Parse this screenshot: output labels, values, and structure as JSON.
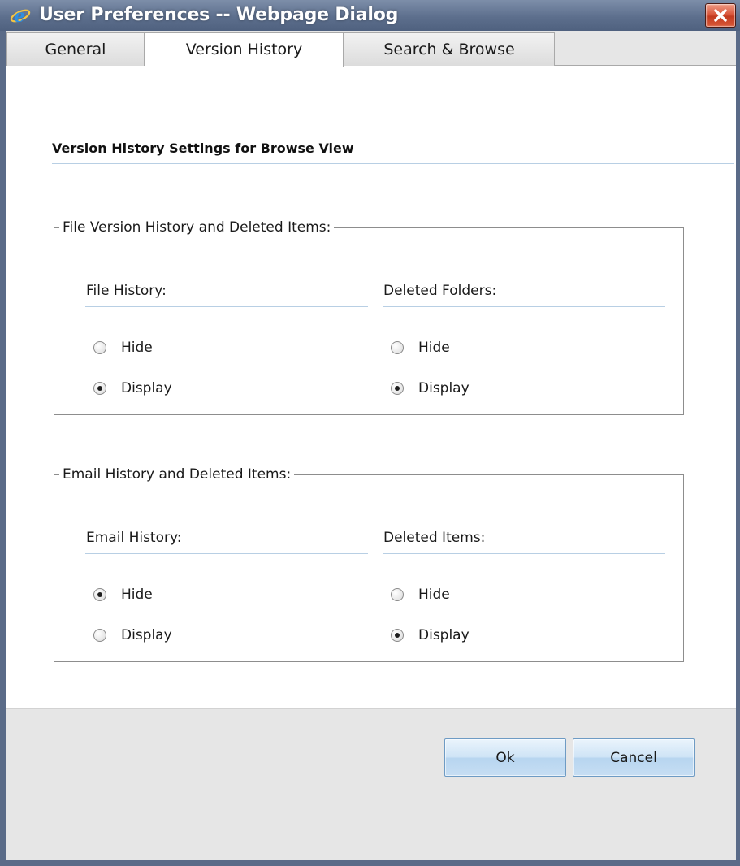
{
  "window": {
    "title": "User Preferences -- Webpage Dialog",
    "app_icon": "ie-icon",
    "close_icon": "close-icon",
    "colors": {
      "titlebar": "#5d6f8d",
      "close": "#d9553a"
    }
  },
  "tabs": [
    {
      "label": "General",
      "active": false
    },
    {
      "label": "Version History",
      "active": true
    },
    {
      "label": "Search & Browse",
      "active": false
    }
  ],
  "main": {
    "heading": "Version History Settings for Browse View",
    "groups": [
      {
        "legend": "File Version History and Deleted Items:",
        "columns": [
          {
            "label": "File History:",
            "options": [
              {
                "label": "Hide",
                "checked": false
              },
              {
                "label": "Display",
                "checked": true
              }
            ]
          },
          {
            "label": "Deleted Folders:",
            "options": [
              {
                "label": "Hide",
                "checked": false
              },
              {
                "label": "Display",
                "checked": true
              }
            ]
          }
        ]
      },
      {
        "legend": "Email History and Deleted Items:",
        "columns": [
          {
            "label": "Email History:",
            "options": [
              {
                "label": "Hide",
                "checked": true
              },
              {
                "label": "Display",
                "checked": false
              }
            ]
          },
          {
            "label": "Deleted Items:",
            "options": [
              {
                "label": "Hide",
                "checked": false
              },
              {
                "label": "Display",
                "checked": true
              }
            ]
          }
        ]
      }
    ]
  },
  "footer": {
    "ok_label": "Ok",
    "cancel_label": "Cancel"
  }
}
